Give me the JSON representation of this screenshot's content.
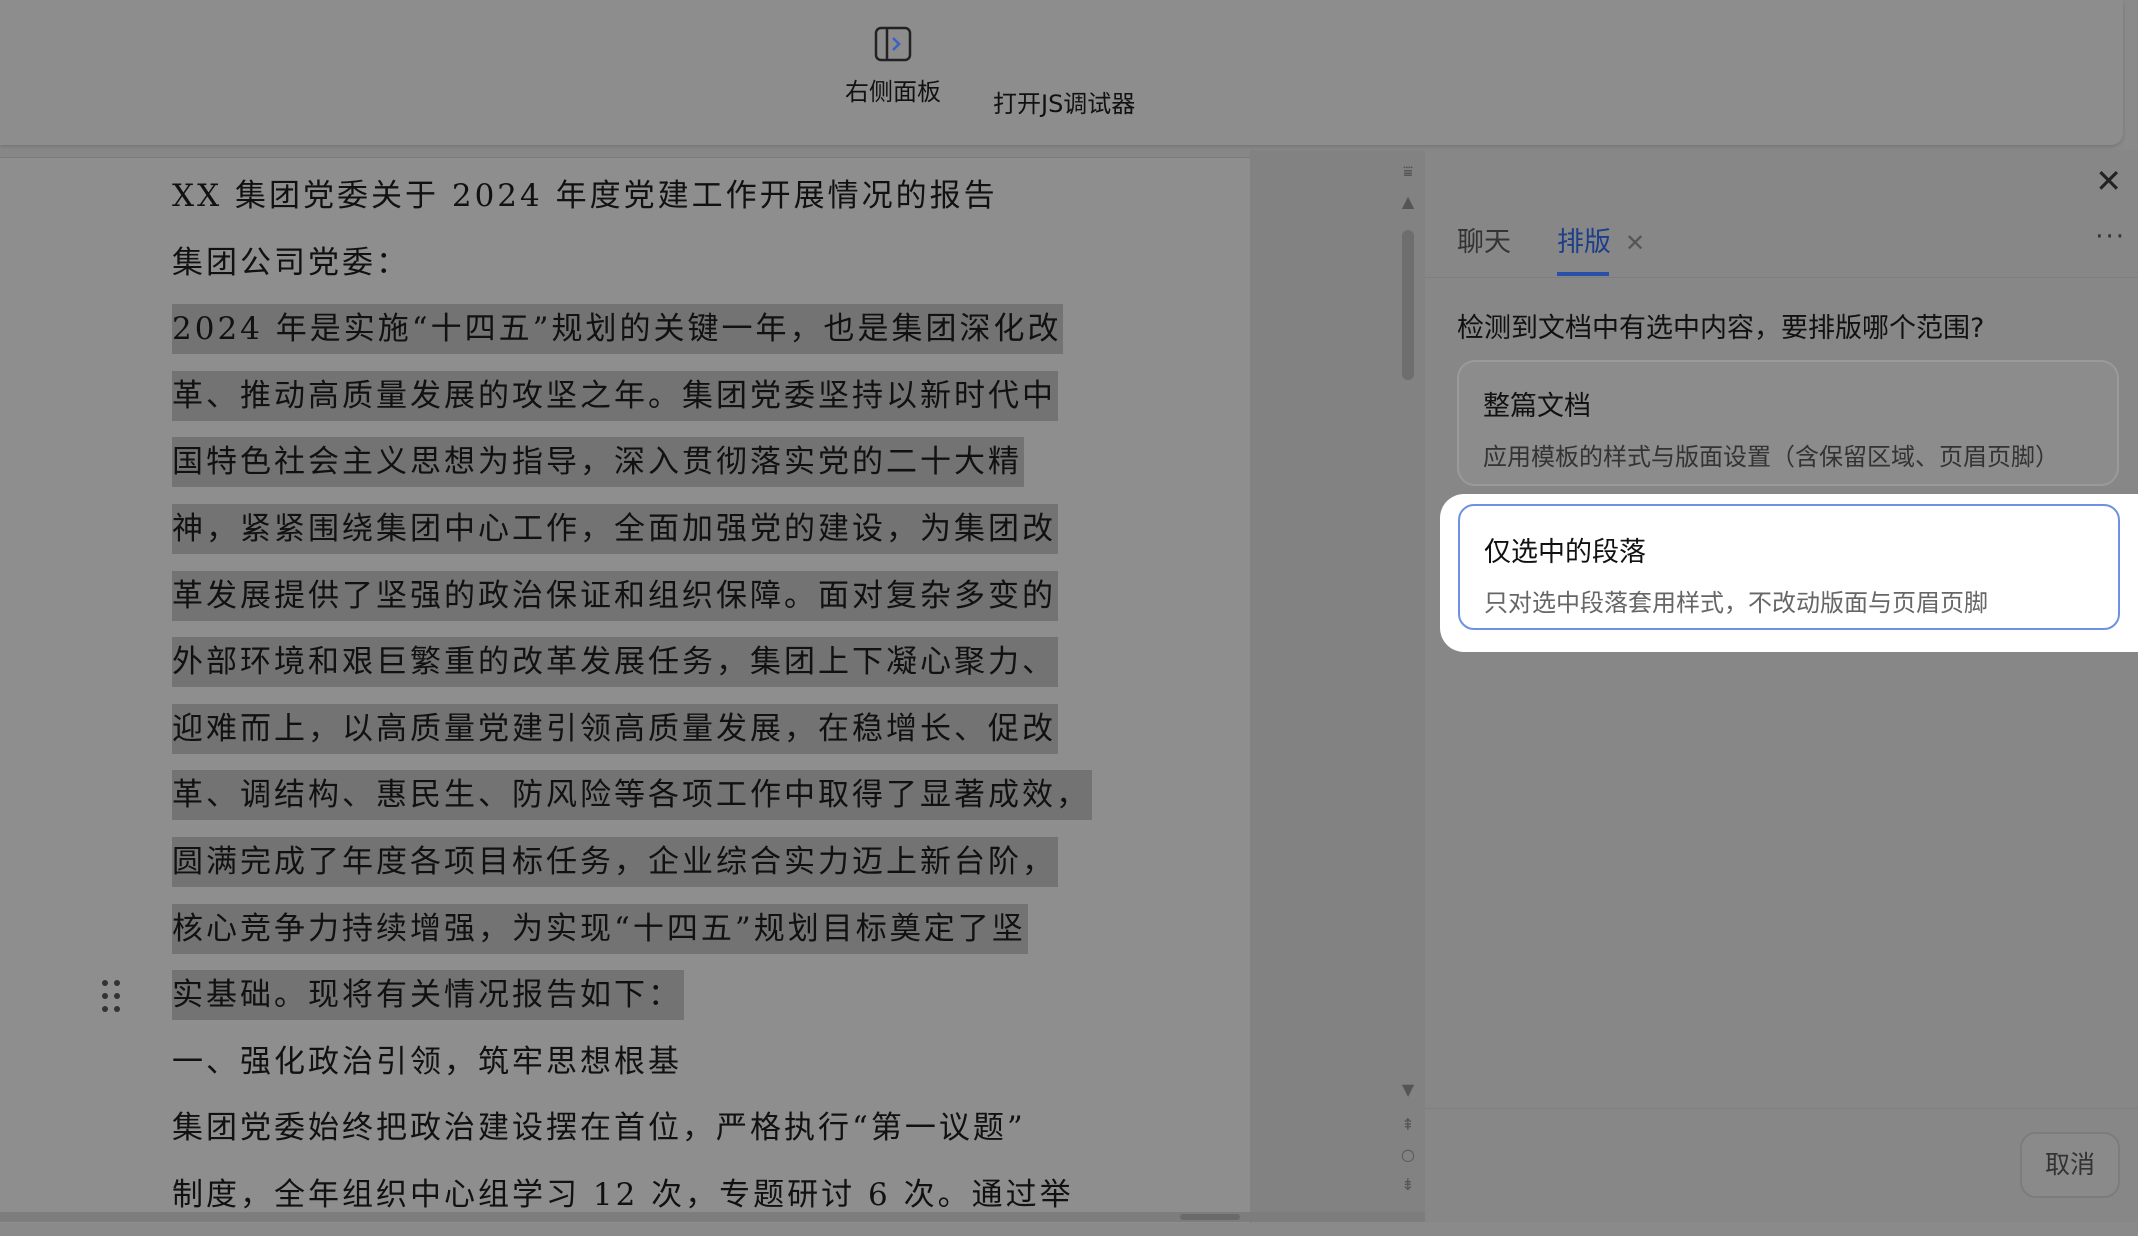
{
  "toolbar": {
    "right_panel_label": "右侧面板",
    "js_debugger_label": "打开JS调试器"
  },
  "document": {
    "lines": [
      {
        "text": "XX 集团党委关于 2024 年度党建工作开展情况的报告",
        "selected": false
      },
      {
        "text": "集团公司党委：",
        "selected": false
      },
      {
        "text": "2024 年是实施“十四五”规划的关键一年，也是集团深化改",
        "selected": true
      },
      {
        "text": "革、推动高质量发展的攻坚之年。集团党委坚持以新时代中",
        "selected": true
      },
      {
        "text": "国特色社会主义思想为指导，深入贯彻落实党的二十大精",
        "selected": true
      },
      {
        "text": "神，紧紧围绕集团中心工作，全面加强党的建设，为集团改",
        "selected": true
      },
      {
        "text": "革发展提供了坚强的政治保证和组织保障。面对复杂多变的",
        "selected": true
      },
      {
        "text": "外部环境和艰巨繁重的改革发展任务，集团上下凝心聚力、",
        "selected": true
      },
      {
        "text": "迎难而上，以高质量党建引领高质量发展，在稳增长、促改",
        "selected": true
      },
      {
        "text": "革、调结构、惠民生、防风险等各项工作中取得了显著成效，",
        "selected": true
      },
      {
        "text": "圆满完成了年度各项目标任务，企业综合实力迈上新台阶，",
        "selected": true
      },
      {
        "text": "核心竞争力持续增强，为实现“十四五”规划目标奠定了坚",
        "selected": true
      },
      {
        "text": "实基础。现将有关情况报告如下：",
        "selected": true
      },
      {
        "text": "一、强化政治引领，筑牢思想根基",
        "selected": false
      },
      {
        "text": "集团党委始终把政治建设摆在首位，严格执行“第一议题”",
        "selected": false
      },
      {
        "text": "制度，全年组织中心组学习 12 次，专题研讨 6 次。通过举",
        "selected": false
      }
    ]
  },
  "panel": {
    "tabs": [
      {
        "label": "聊天",
        "active": false
      },
      {
        "label": "排版",
        "active": true
      }
    ],
    "tab_close": "✕",
    "more": "···",
    "close": "✕",
    "question": "检测到文档中有选中内容，要排版哪个范围?",
    "options": [
      {
        "title": "整篇文档",
        "desc": "应用模板的样式与版面设置（含保留区域、页眉页脚）"
      },
      {
        "title": "仅选中的段落",
        "desc": "只对选中段落套用样式，不改动版面与页眉页脚"
      }
    ],
    "cancel_label": "取消"
  }
}
